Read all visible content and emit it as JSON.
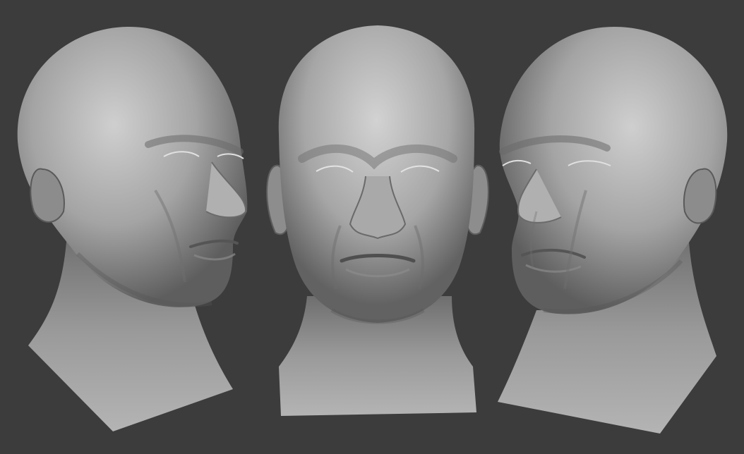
{
  "viewport": {
    "background_color": "#3c3c3c",
    "clay_color": "#9a9a9a",
    "shadow_color": "#4a4a4a",
    "highlight_color": "#c8c8c8"
  },
  "views": [
    {
      "name": "three-quarter-right",
      "description_icon": "head-sculpt"
    },
    {
      "name": "front",
      "description_icon": "head-sculpt"
    },
    {
      "name": "three-quarter-left",
      "description_icon": "head-sculpt"
    }
  ]
}
